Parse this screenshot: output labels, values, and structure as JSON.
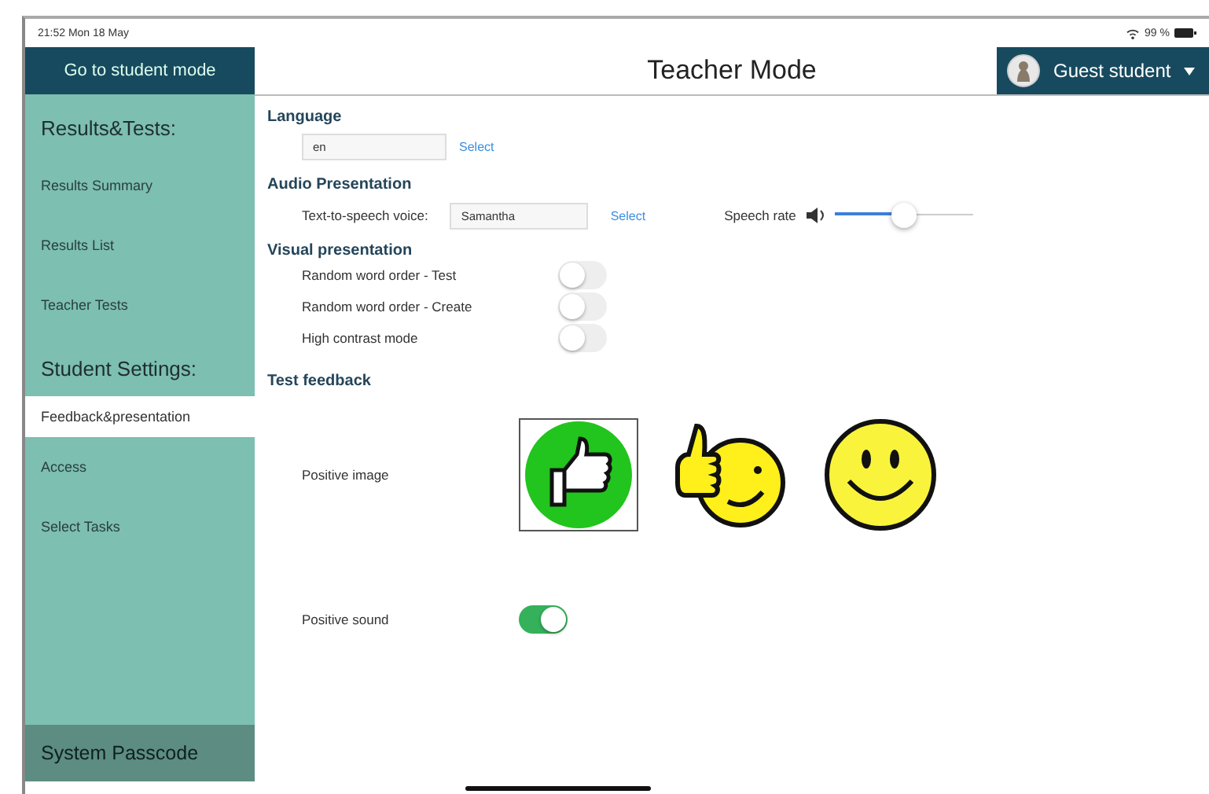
{
  "status_bar": {
    "time": "21:52  Mon 18 May",
    "battery": "99 %"
  },
  "sidebar": {
    "button": "Go to student mode",
    "sections": [
      {
        "heading": "Results&Tests:",
        "items": [
          {
            "label": "Results Summary",
            "selected": false
          },
          {
            "label": "Results List",
            "selected": false
          },
          {
            "label": "Teacher Tests",
            "selected": false
          }
        ]
      },
      {
        "heading": "Student Settings:",
        "items": [
          {
            "label": "Feedback&presentation",
            "selected": true
          },
          {
            "label": "Access",
            "selected": false
          },
          {
            "label": "Select Tasks",
            "selected": false
          }
        ]
      }
    ],
    "footer": "System Passcode"
  },
  "header": {
    "title": "Teacher Mode",
    "user": "Guest student"
  },
  "language": {
    "heading": "Language",
    "value": "en",
    "select": "Select"
  },
  "audio": {
    "heading": "Audio Presentation",
    "label": "Text-to-speech voice:",
    "value": "Samantha",
    "select": "Select",
    "rate_label": "Speech rate",
    "rate": {
      "level": 0.49
    }
  },
  "visual": {
    "heading": "Visual presentation",
    "toggles": [
      {
        "label": "Random word order - Test",
        "on": false
      },
      {
        "label": "Random word order - Create",
        "on": false
      },
      {
        "label": "High contrast mode",
        "on": false
      }
    ]
  },
  "feedback": {
    "heading": "Test feedback",
    "image_label": "Positive image",
    "images": [
      {
        "kind": "thumb-circle",
        "selected": true
      },
      {
        "kind": "thumb-smiley",
        "selected": false
      },
      {
        "kind": "smiley",
        "selected": false
      }
    ],
    "sound_label": "Positive sound",
    "sound_on": true
  }
}
